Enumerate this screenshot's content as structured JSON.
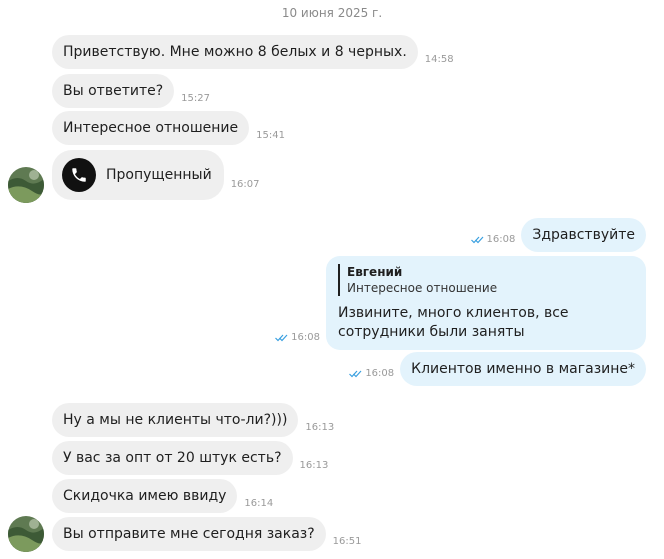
{
  "date_separator": "10 июня 2025 г.",
  "colors": {
    "incoming_bubble": "#efefef",
    "outgoing_bubble": "#e3f3fc",
    "read_ticks": "#3aa0e0"
  },
  "messages": [
    {
      "text": "Приветствую. Мне можно 8 белых и 8 черных.",
      "time": "14:58"
    },
    {
      "text": "Вы ответите?",
      "time": "15:27"
    },
    {
      "text": "Интересное отношение",
      "time": "15:41"
    },
    {
      "text": "Пропущенный",
      "time": "16:07",
      "icon": "phone-icon"
    },
    {
      "text": "Здравствуйте",
      "time": "16:08"
    },
    {
      "reply_author": "Евгений",
      "reply_quote": "Интересное отношение",
      "text": "Извините, много клиентов, все сотрудники были заняты",
      "time": "16:08"
    },
    {
      "text": "Клиентов именно в магазине*",
      "time": "16:08"
    },
    {
      "text": "Ну а мы не клиенты что-ли?)))",
      "time": "16:13"
    },
    {
      "text": "У вас за опт от 20 штук есть?",
      "time": "16:13"
    },
    {
      "text": "Скидочка имею ввиду",
      "time": "16:14"
    },
    {
      "text": "Вы отправите мне сегодня заказ?",
      "time": "16:51"
    }
  ]
}
